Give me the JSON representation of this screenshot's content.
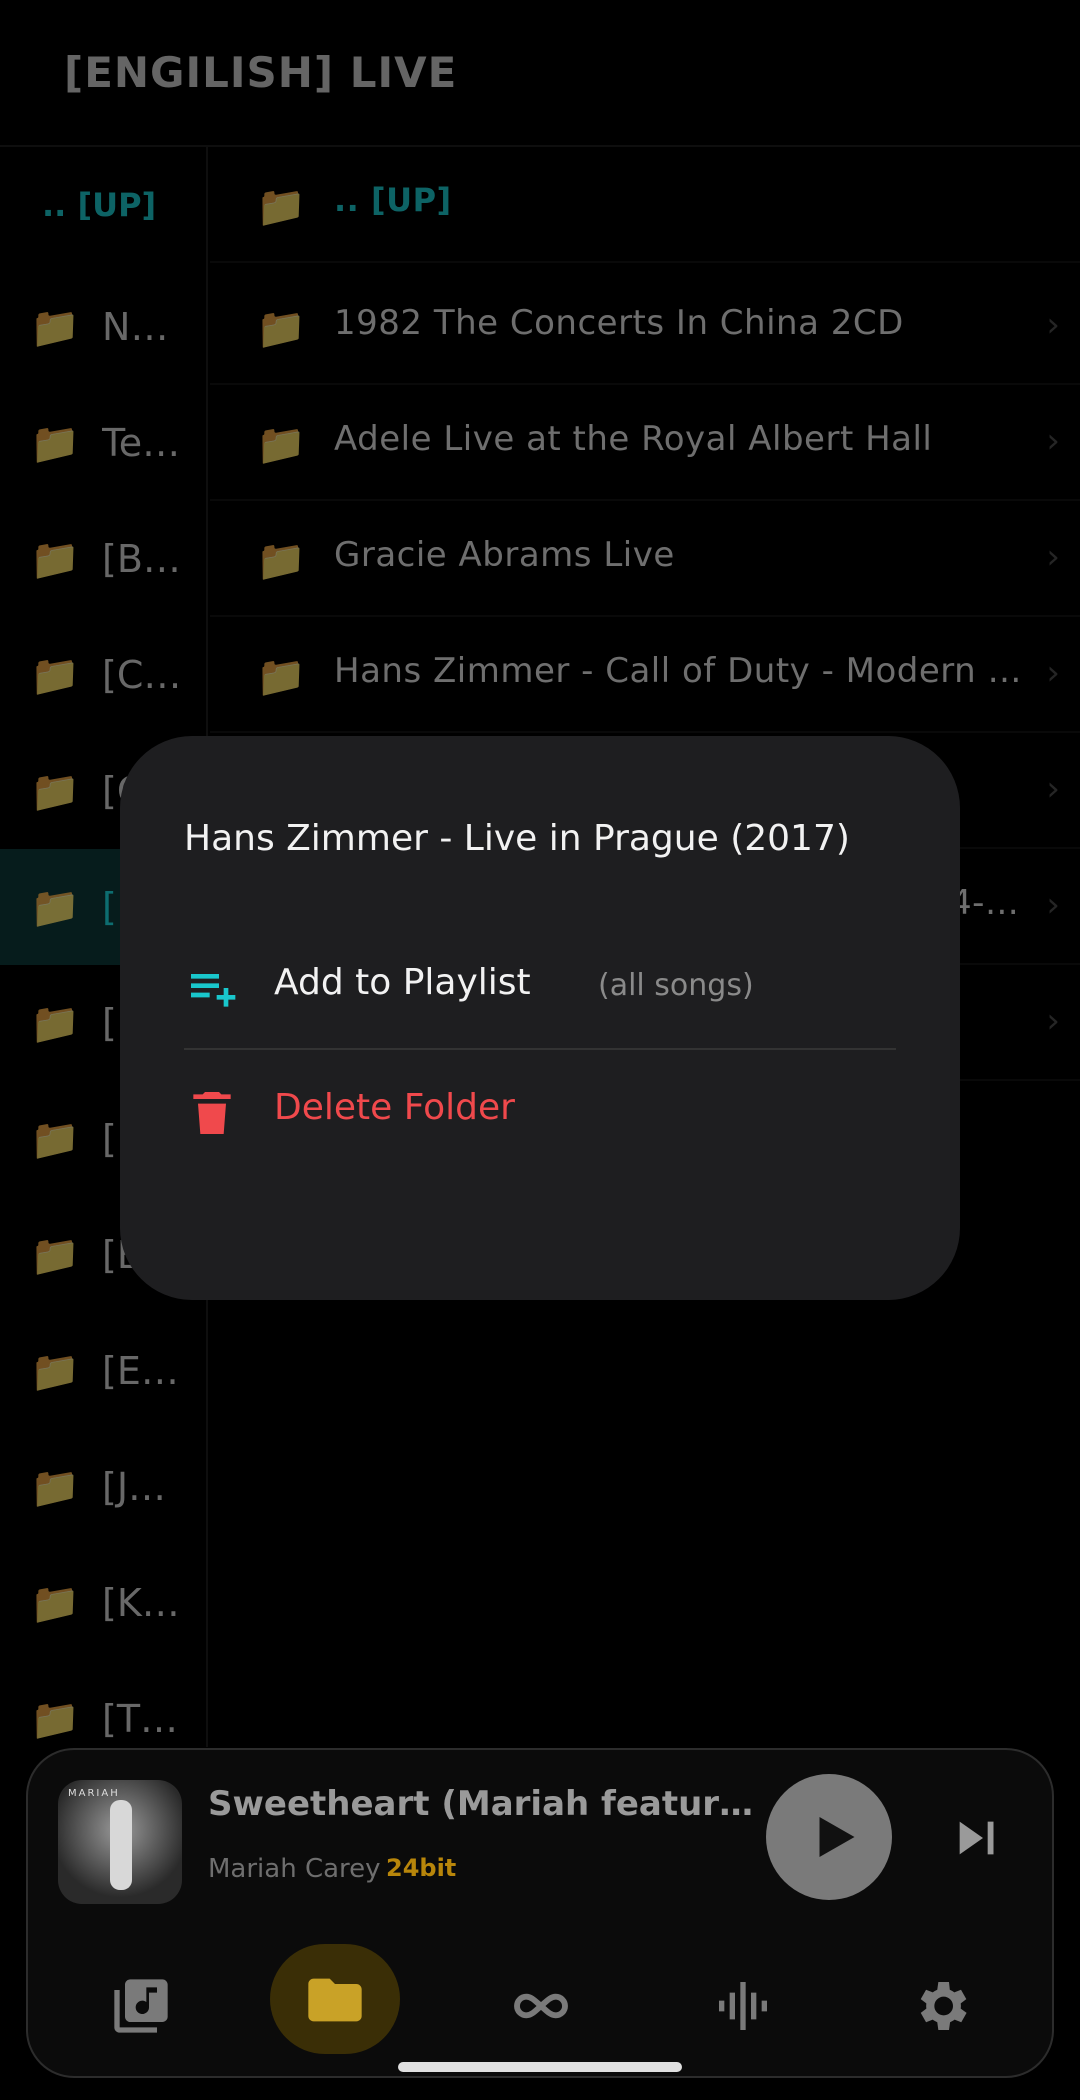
{
  "header": {
    "title": "[ENGILISH] LIVE"
  },
  "left_list": {
    "up_label": ".. [UP]",
    "items": [
      {
        "label": "No…"
      },
      {
        "label": "Te…"
      },
      {
        "label": "[B…"
      },
      {
        "label": "[C…"
      },
      {
        "label": "[C…"
      },
      {
        "label": "[E…",
        "selected": true
      },
      {
        "label": "[E…"
      },
      {
        "label": "[E…"
      },
      {
        "label": "[E…"
      },
      {
        "label": "[E…"
      },
      {
        "label": "[J…"
      },
      {
        "label": "[K…"
      },
      {
        "label": "[T…"
      }
    ]
  },
  "right_list": {
    "up_label": ".. [UP]",
    "items": [
      {
        "label": "1982 The Concerts In China 2CD"
      },
      {
        "label": "Adele Live at the Royal Albert Hall"
      },
      {
        "label": "Gracie Abrams Live"
      },
      {
        "label": "Hans Zimmer - Call of Duty - Modern Wa…"
      },
      {
        "label": ""
      },
      {
        "label": "4-…"
      },
      {
        "label": ""
      }
    ]
  },
  "dialog": {
    "title": "Hans Zimmer - Live in Prague (2017)",
    "add_playlist_label": "Add to Playlist",
    "add_playlist_sub": "(all songs)",
    "delete_label": "Delete Folder"
  },
  "player": {
    "album_brand": "MARIAH",
    "song_title": "Sweetheart (Mariah featuring J.…",
    "artist": "Mariah Carey",
    "bit_depth": "24bit"
  },
  "nav": {
    "items": [
      {
        "icon": "music-library-icon"
      },
      {
        "icon": "folder-icon",
        "active": true
      },
      {
        "icon": "infinity-icon"
      },
      {
        "icon": "waveform-icon"
      },
      {
        "icon": "settings-gear-icon"
      }
    ]
  },
  "colors": {
    "accent_teal": "#19b4b8",
    "delete_red": "#f0494c",
    "bitdepth_gold": "#b8860b",
    "folder_yellow": "#c9a227"
  }
}
